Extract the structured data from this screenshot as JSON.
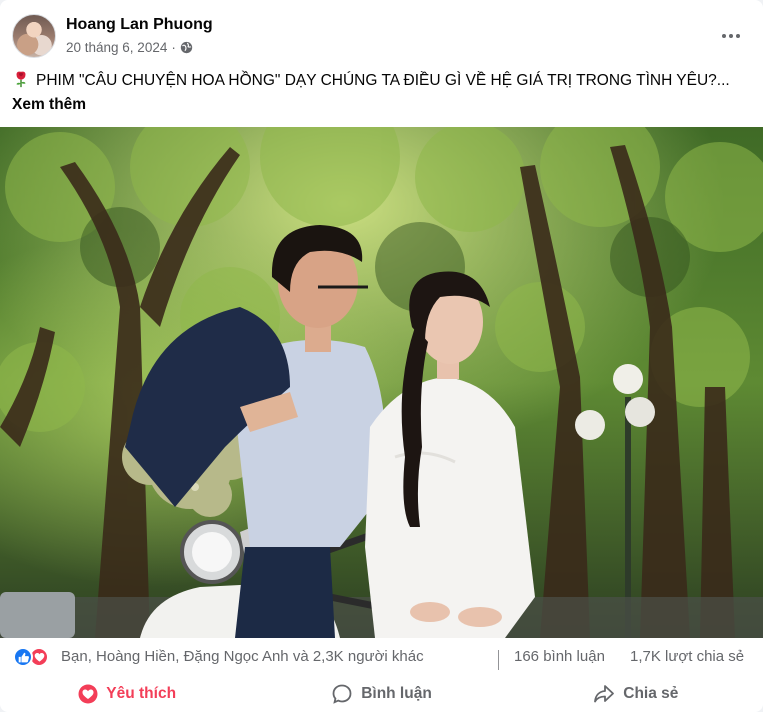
{
  "post": {
    "author": "Hoang Lan Phuong",
    "date": "20 tháng 6, 2024",
    "audience_icon": "globe-icon",
    "text": "PHIM \"CÂU CHUYỆN HOA HỒNG\" DẠY CHÚNG TA ĐIỀU GÌ VỀ HỆ GIÁ TRỊ TRONG TÌNH YÊU?...",
    "text_icon": "rose-icon",
    "see_more": "Xem thêm"
  },
  "reactions": {
    "icons": [
      "like-icon",
      "love-icon"
    ],
    "summary": "Bạn, Hoàng Hiền, Đặng Ngọc Anh và 2,3K người khác",
    "comments": "166 bình luận",
    "shares": "1,7K lượt chia sẻ"
  },
  "actions": {
    "like_label": "Yêu thích",
    "comment_label": "Bình luận",
    "share_label": "Chia sẻ"
  },
  "colors": {
    "text_primary": "#050505",
    "text_secondary": "#65676b",
    "like_blue": "#1877f2",
    "love_red": "#f33e58"
  }
}
